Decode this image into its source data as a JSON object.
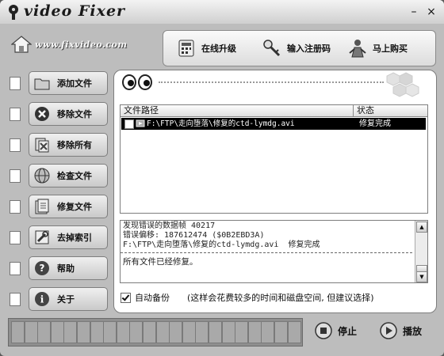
{
  "app": {
    "title": "video Fixer"
  },
  "header": {
    "website": "www.fixvideo.com"
  },
  "toolbar": {
    "items": [
      {
        "label": "在线升级",
        "icon": "calculator-icon"
      },
      {
        "label": "输入注册码",
        "icon": "key-icon"
      },
      {
        "label": "马上购买",
        "icon": "person-icon"
      }
    ]
  },
  "sidebar": {
    "items": [
      {
        "label": "添加文件",
        "icon": "folder-icon"
      },
      {
        "label": "移除文件",
        "icon": "close-icon"
      },
      {
        "label": "移除所有",
        "icon": "files-icon"
      },
      {
        "label": "检查文件",
        "icon": "globe-icon"
      },
      {
        "label": "修复文件",
        "icon": "repair-icon"
      },
      {
        "label": "去掉索引",
        "icon": "wrench-icon"
      },
      {
        "label": "帮助",
        "icon": "help-icon"
      },
      {
        "label": "关于",
        "icon": "info-icon"
      }
    ]
  },
  "file_list": {
    "columns": [
      "文件路径",
      "状态"
    ],
    "rows": [
      {
        "path": "F:\\FTP\\走向堕落\\修复的ctd-lymdg.avi",
        "status": "修复完成",
        "checked": false,
        "selected": true
      }
    ]
  },
  "log": {
    "lines": [
      "发现错误的数据帧 40217",
      "错误偏移: 187612474 ($0B2EBD3A)",
      "F:\\FTP\\走向堕落\\修复的ctd-lymdg.avi  修复完成"
    ],
    "summary": "所有文件已经修复。"
  },
  "backup": {
    "label": "自动备份",
    "checked": true,
    "note": "(这样会花费较多的时间和磁盘空间, 但建议选择)"
  },
  "progress": {
    "fraction": 0.0,
    "segments": 22
  },
  "controls": {
    "stop_label": "停止",
    "play_label": "播放"
  },
  "window": {
    "minimize": "–",
    "close": "×"
  }
}
